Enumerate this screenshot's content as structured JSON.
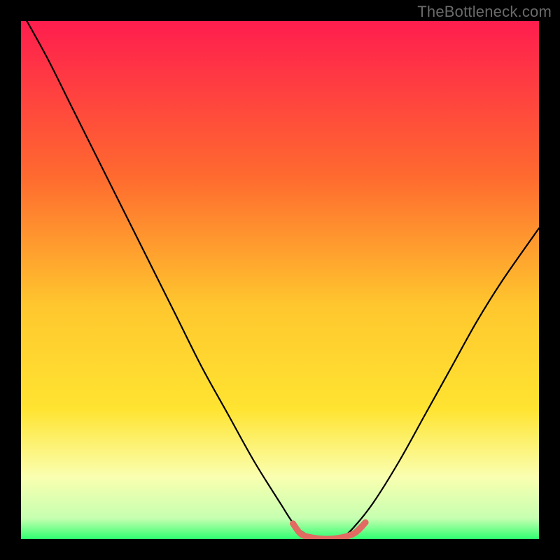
{
  "watermark": "TheBottleneck.com",
  "colors": {
    "bg_black": "#000000",
    "watermark_gray": "#6a6a6a",
    "curve_black": "#000000",
    "highlight_red": "#e16a62",
    "gradient_top": "#ff1d4e",
    "gradient_mid1": "#ff8a2a",
    "gradient_mid2": "#ffe431",
    "gradient_low": "#faffb0",
    "gradient_bottom": "#2fff70"
  },
  "chart_data": {
    "type": "line",
    "title": "",
    "xlabel": "",
    "ylabel": "",
    "xlim": [
      0,
      1
    ],
    "ylim": [
      0,
      1
    ],
    "series": [
      {
        "name": "bottleneck-curve",
        "x": [
          0.0,
          0.05,
          0.1,
          0.15,
          0.2,
          0.25,
          0.3,
          0.35,
          0.4,
          0.45,
          0.5,
          0.53,
          0.56,
          0.59,
          0.62,
          0.64,
          0.68,
          0.73,
          0.78,
          0.83,
          0.88,
          0.93,
          1.0
        ],
        "y": [
          1.02,
          0.93,
          0.83,
          0.73,
          0.63,
          0.53,
          0.43,
          0.33,
          0.24,
          0.15,
          0.07,
          0.025,
          0.005,
          0.0,
          0.005,
          0.02,
          0.07,
          0.15,
          0.24,
          0.33,
          0.42,
          0.5,
          0.6
        ]
      }
    ],
    "highlight_segment": {
      "name": "valley-highlight",
      "x": [
        0.525,
        0.54,
        0.56,
        0.59,
        0.62,
        0.645,
        0.665
      ],
      "y": [
        0.03,
        0.01,
        0.003,
        0.0,
        0.003,
        0.012,
        0.032
      ]
    }
  }
}
